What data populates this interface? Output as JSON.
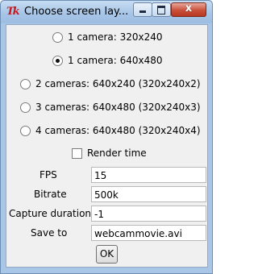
{
  "window": {
    "title": "Choose screen lay...",
    "app_icon_text": "Tk",
    "close_glyph": "x"
  },
  "layouts": [
    {
      "label": "1 camera:  320x240",
      "selected": false
    },
    {
      "label": "1 camera:  640x480",
      "selected": true
    },
    {
      "label": "2 cameras: 640x240 (320x240x2)",
      "selected": false
    },
    {
      "label": "3 cameras: 640x480 (320x240x3)",
      "selected": false
    },
    {
      "label": "4 cameras: 640x480 (320x240x4)",
      "selected": false
    }
  ],
  "render_time": {
    "label": "Render time",
    "checked": false
  },
  "fields": [
    {
      "label": "FPS",
      "value": "15"
    },
    {
      "label": "Bitrate",
      "value": "500k"
    },
    {
      "label": "Capture duration",
      "value": "-1"
    },
    {
      "label": "Save to",
      "value": "webcammovie.avi"
    }
  ],
  "ok_label": "OK"
}
